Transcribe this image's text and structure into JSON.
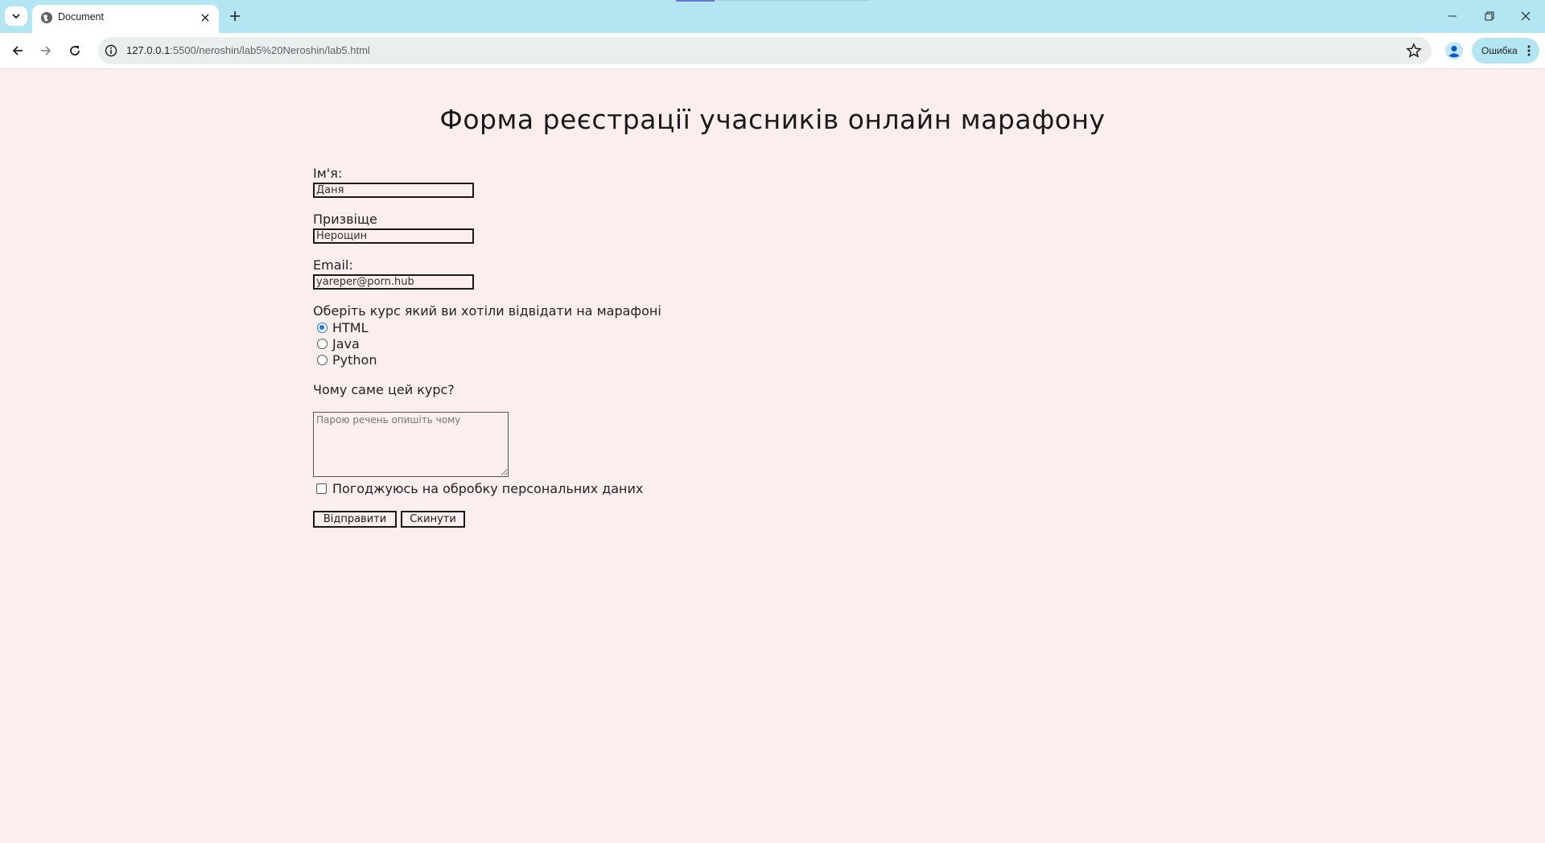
{
  "browser": {
    "tab_title": "Document",
    "url_host": "127.0.0.1",
    "url_path": ":5500/neroshin/lab5%20Neroshin/lab5.html",
    "profile_status": "Ошибка",
    "accent_color": "#b4e5f2"
  },
  "icons": {
    "tab_search": "chevron-down-icon",
    "favicon": "globe-icon",
    "tab_close": "close-icon",
    "new_tab": "plus-icon",
    "back": "arrow-left-icon",
    "forward": "arrow-right-icon",
    "reload": "reload-icon",
    "site_info": "info-icon",
    "bookmark": "star-icon",
    "profile": "person-icon",
    "menu": "kebab-icon",
    "minimize": "minimize-icon",
    "restore": "restore-icon",
    "close_window": "close-window-icon"
  },
  "page": {
    "title": "Форма реєстрації учасників онлайн марафону",
    "background": "#fdeeee"
  },
  "form": {
    "first_name": {
      "label": "Ім'я:",
      "value": "Даня"
    },
    "last_name": {
      "label": "Призвіще",
      "value": "Нерощин"
    },
    "email": {
      "label": "Email:",
      "value": "yareper@porn.hub"
    },
    "course": {
      "label": "Оберіть курс який ви хотіли відвідати на марафоні",
      "options": [
        "HTML",
        "Java",
        "Python"
      ],
      "selected": "HTML"
    },
    "reason": {
      "label": "Чому саме цей курс?",
      "placeholder": "Парою речень опишіть чому"
    },
    "consent": {
      "label": "Погоджуюсь на обробку персональних даних",
      "checked": false
    },
    "submit_label": "Відправити",
    "reset_label": "Скинути"
  }
}
